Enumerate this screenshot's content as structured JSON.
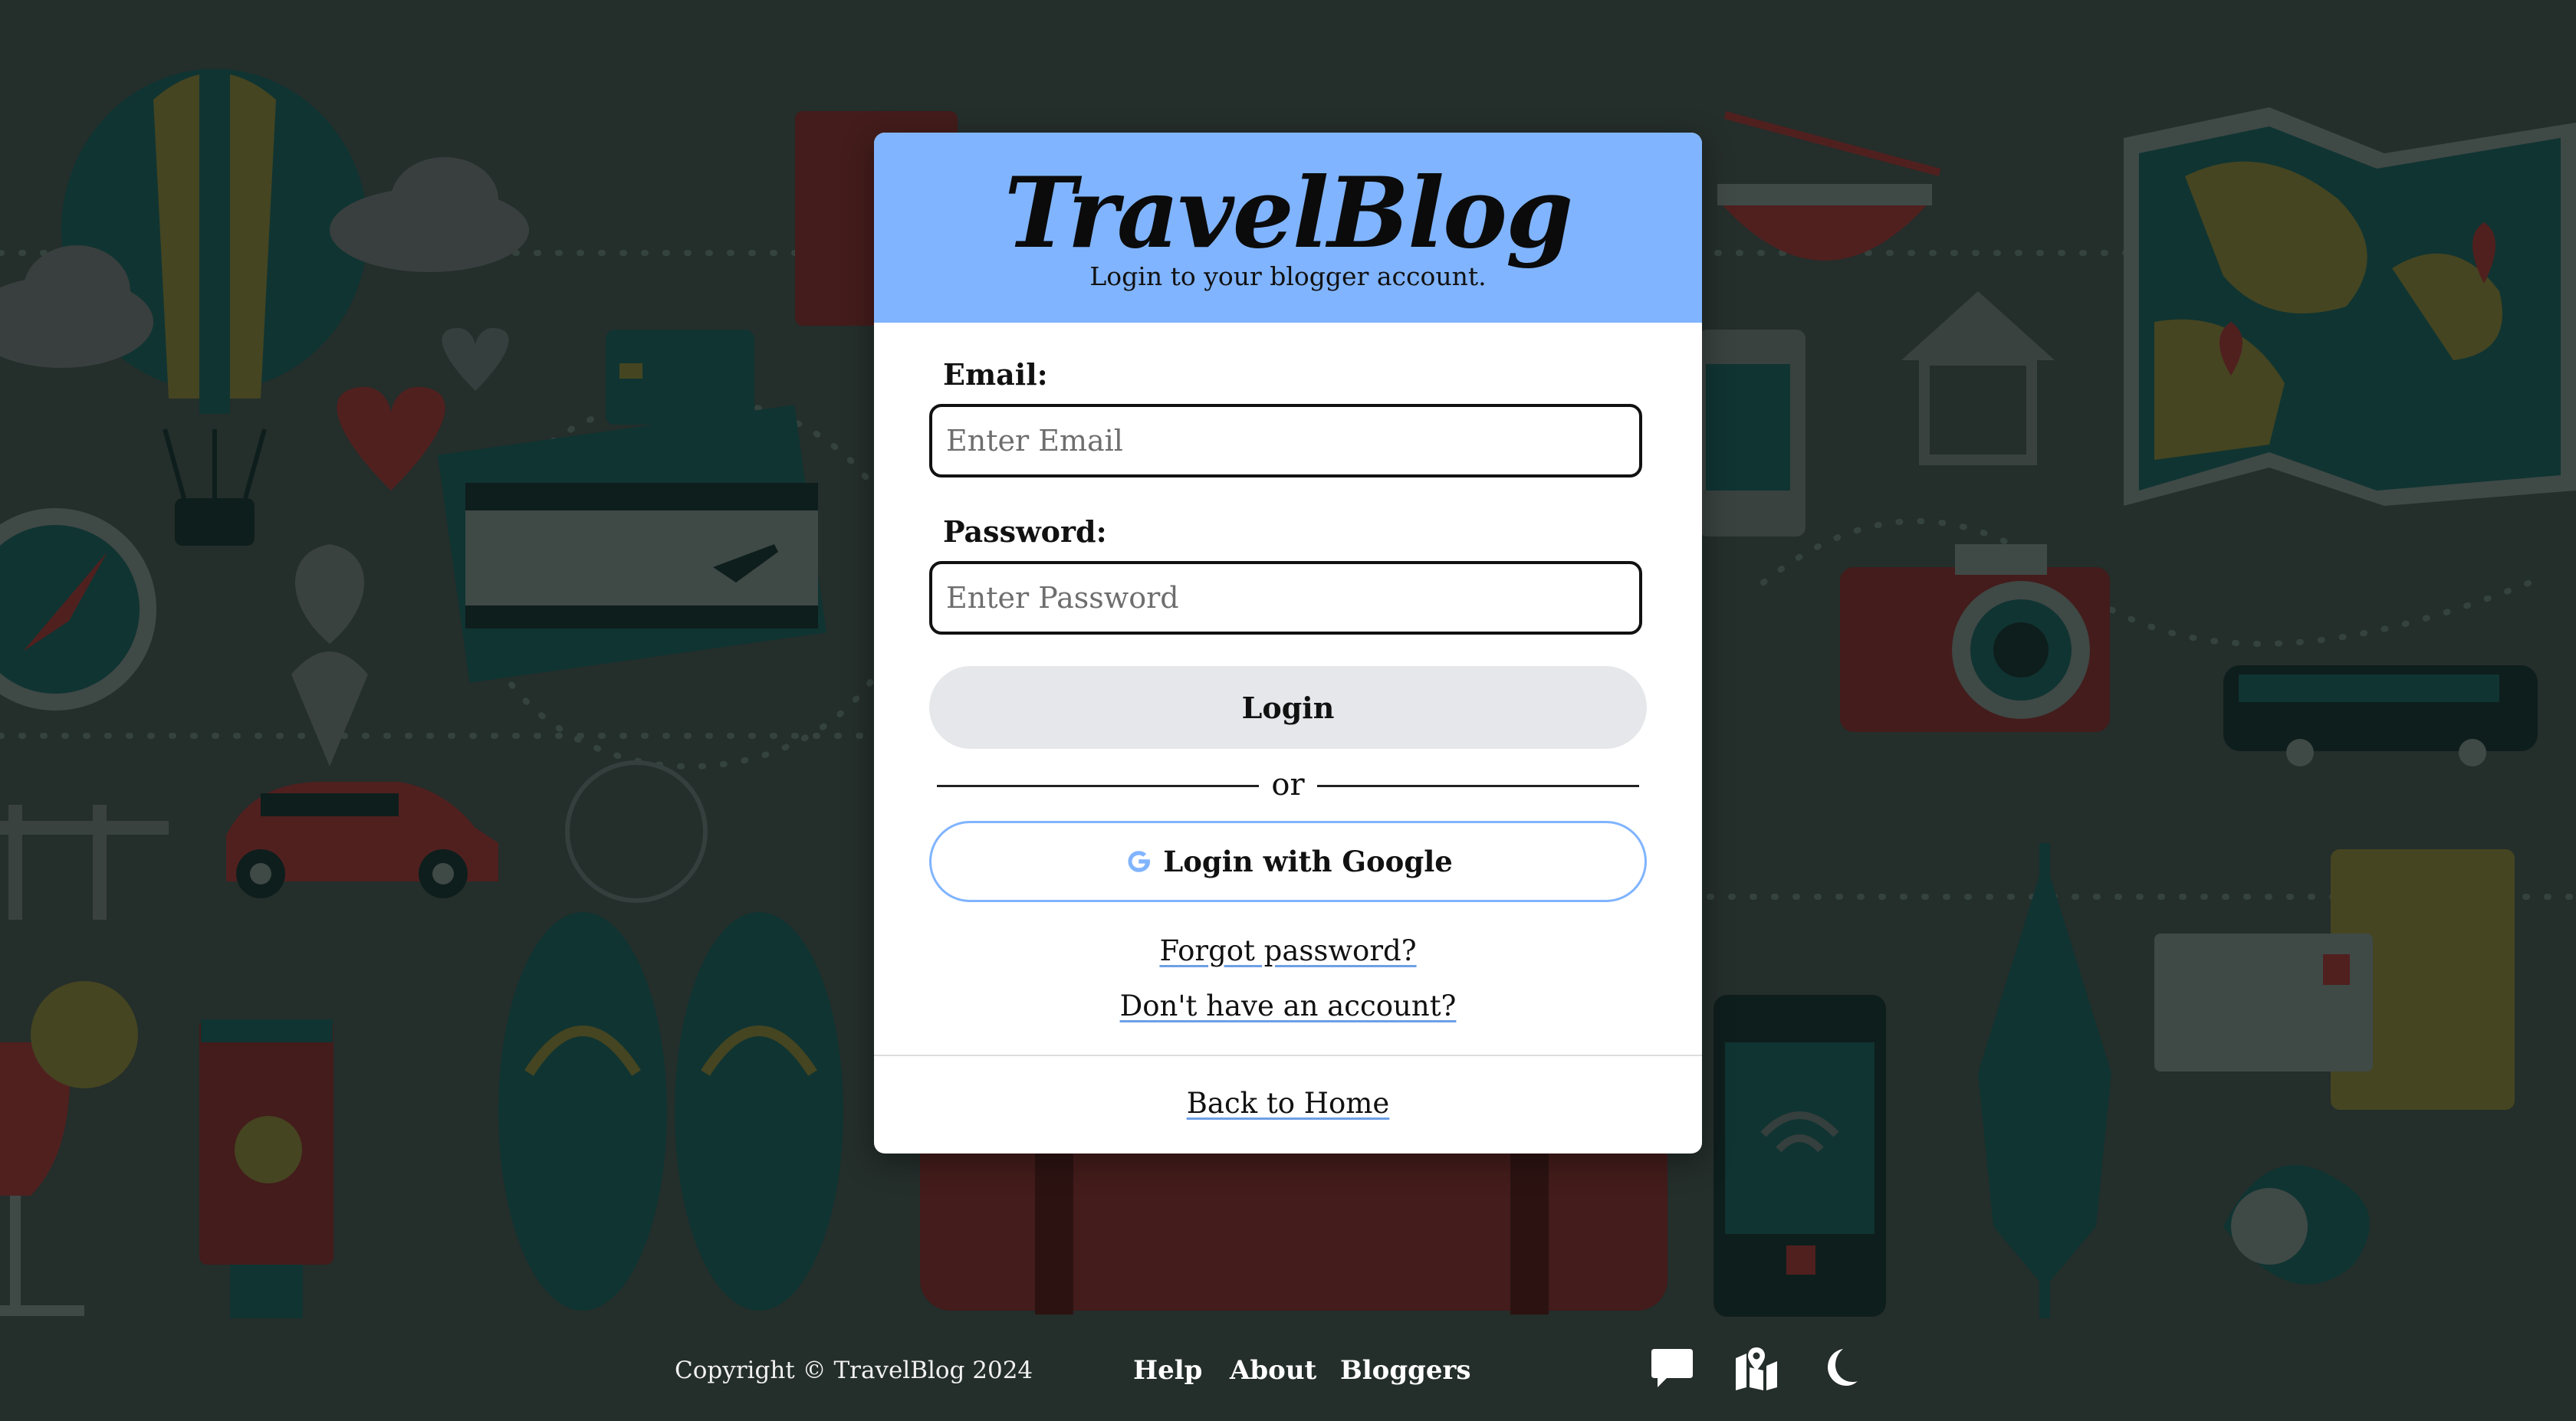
{
  "app": {
    "brand": "TravelBlog",
    "subtitle": "Login to your blogger account."
  },
  "form": {
    "email_label": "Email:",
    "email_placeholder": "Enter Email",
    "email_value": "",
    "password_label": "Password:",
    "password_placeholder": "Enter Password",
    "password_value": "",
    "login_label": "Login",
    "or_text": "or",
    "google_label": "Login with Google",
    "forgot_label": "Forgot password?",
    "signup_label": "Don't have an account?",
    "home_label": "Back to Home"
  },
  "footer": {
    "copyright": "Copyright © TravelBlog 2024",
    "links": [
      "Help",
      "About",
      "Bloggers"
    ],
    "icons": [
      "chat-icon",
      "map-icon",
      "moon-icon"
    ]
  },
  "colors": {
    "header_accent": "#80b4ff",
    "google_border": "#80b4ff",
    "login_button": "#e6e7eb",
    "page_background": "#1d2a27"
  }
}
